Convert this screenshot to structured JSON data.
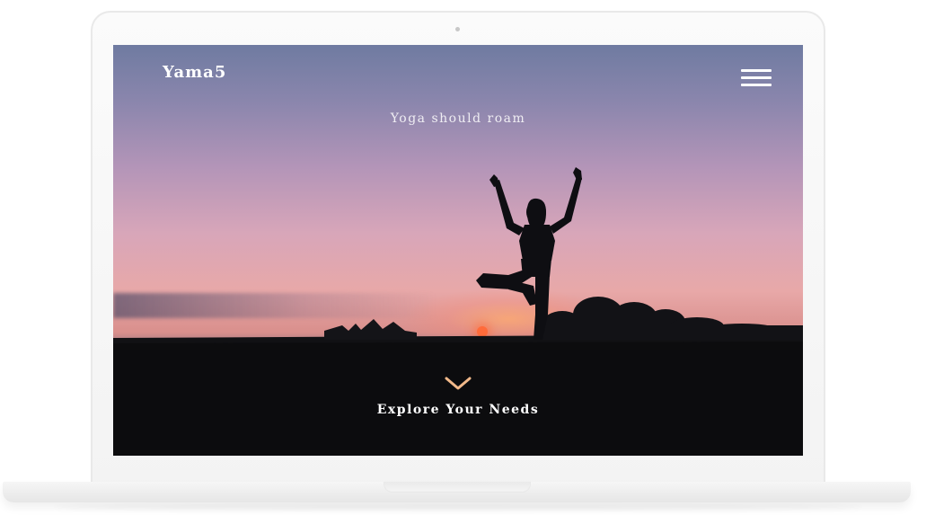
{
  "site": {
    "brand": "Yama5",
    "tagline": "Yoga should roam",
    "cta_label": "Explore Your Needs"
  },
  "icons": {
    "menu": "hamburger-menu-icon",
    "scroll": "chevron-down-icon"
  },
  "colors": {
    "chevron": "#f2b98a",
    "text": "#ffffff",
    "ground": "#0c0c0e"
  }
}
